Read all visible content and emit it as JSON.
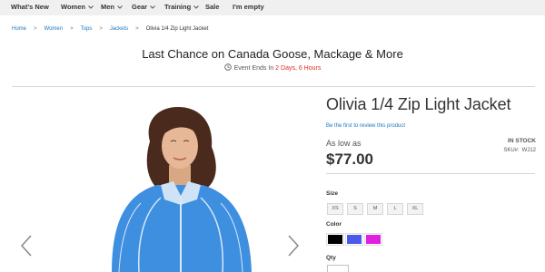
{
  "nav": {
    "items": [
      {
        "label": "What's New",
        "has_menu": false
      },
      {
        "label": "Women",
        "has_menu": true
      },
      {
        "label": "Men",
        "has_menu": true
      },
      {
        "label": "Gear",
        "has_menu": true
      },
      {
        "label": "Training",
        "has_menu": true
      },
      {
        "label": "Sale",
        "has_menu": false
      },
      {
        "label": "I'm empty",
        "has_menu": false
      }
    ]
  },
  "breadcrumb": {
    "items": [
      "Home",
      "Women",
      "Tops",
      "Jackets"
    ],
    "current": "Olivia 1/4 Zip Light Jacket",
    "separator": ">"
  },
  "promo": {
    "title": "Last Chance on Canada Goose, Mackage & More",
    "prefix": "Event Ends In",
    "countdown": "2 Days, 6 Hours"
  },
  "product": {
    "name": "Olivia 1/4 Zip Light Jacket",
    "review_link": "Be the first to review this product",
    "price_prefix": "As low as",
    "price": "$77.00",
    "stock_status": "In stock",
    "sku_label": "SKU#:",
    "sku": "WJ12",
    "size_label": "Size",
    "sizes": [
      "XS",
      "S",
      "M",
      "L",
      "XL"
    ],
    "color_label": "Color",
    "colors": [
      "#000000",
      "#4a59e8",
      "#e020e0"
    ],
    "qty_label": "Qty"
  },
  "gallery": {
    "prev_icon": "chevron-left-icon",
    "next_icon": "chevron-right-icon"
  },
  "theme": {
    "link_color": "#1979c3",
    "countdown_color": "#e02b27",
    "nav_bg": "#f0f0f0"
  }
}
